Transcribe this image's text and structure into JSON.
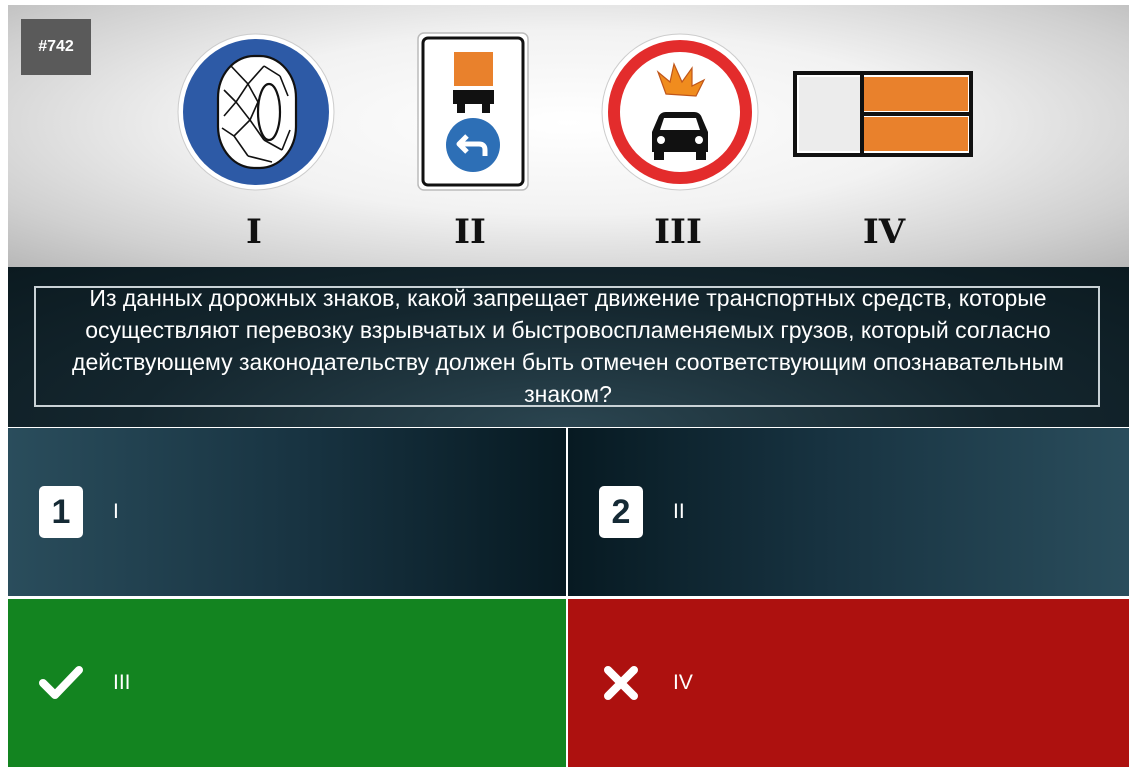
{
  "question_id": "#742",
  "signs": [
    {
      "roman": "I",
      "icon": "snow-chains-required-sign-icon"
    },
    {
      "roman": "II",
      "icon": "dangerous-goods-route-direction-sign-icon"
    },
    {
      "roman": "III",
      "icon": "no-explosive-flammable-cargo-sign-icon"
    },
    {
      "roman": "IV",
      "icon": "orange-hazard-plate-icon"
    }
  ],
  "question": "Из данных дорожных знаков, какой запрещает движение транспортных средств, которые осуществляют перевозку взрывчатых и быстровоспламеняемых грузов, который согласно действующему законодательству должен быть отмечен соответствующим опознавательным знаком?",
  "answers": [
    {
      "number": "1",
      "label": "I",
      "state": "neutral"
    },
    {
      "number": "2",
      "label": "II",
      "state": "neutral"
    },
    {
      "number": "",
      "label": "III",
      "state": "correct",
      "icon": "checkmark-icon"
    },
    {
      "number": "",
      "label": "IV",
      "state": "wrong",
      "icon": "cross-icon"
    }
  ],
  "colors": {
    "correct": "#138420",
    "wrong": "#ad110f",
    "panel_dark": "#0b1a20"
  }
}
